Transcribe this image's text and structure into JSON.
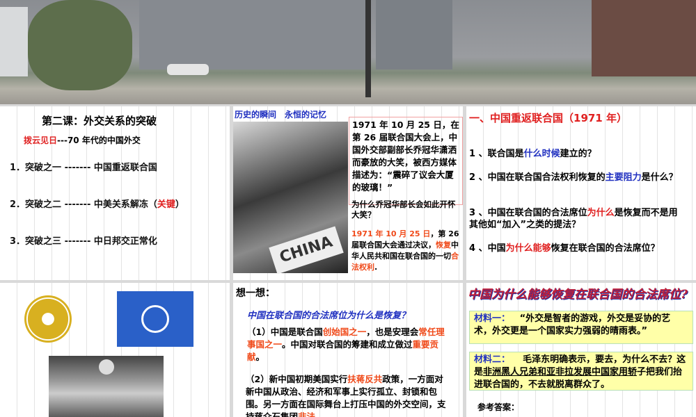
{
  "p1": {
    "title": "第二课：外交关系的突破",
    "subtitle_red": "拨云见日",
    "subtitle_rest": "---70 年代的中国外交",
    "items": [
      {
        "text": "1．突破之一 ------- 中国重返联合国"
      },
      {
        "text": "2．突破之二 ------- 中美关系解冻（",
        "key": "关键",
        "end": "）"
      },
      {
        "text": "3．突破之三 ------- 中日邦交正常化"
      }
    ]
  },
  "p2": {
    "header": "历史的瞬间　永恒的记忆",
    "photo_label": "CHINA",
    "quote": "1971 年 10 月 25 日，在第 26 届联合国大会上，中国外交部副部长乔冠华潇洒而豪放的大笑，被西方媒体描述为：“震碎了议会大厦的玻璃！”",
    "question": "为什么乔冠华部长会如此开怀大笑？",
    "ans": {
      "date": "1971 年 10 月 25 日",
      "t1": "，第 26 届联合国大会通过决议，",
      "restore": "恢复",
      "t2": "中华人民共和国在联合国的一切",
      "rights": "合法权利",
      "t3": "."
    }
  },
  "p3": {
    "title": "一、中国重返联合国（1971 年）",
    "q1": {
      "a": "1 、联合国是",
      "h": "什么时候",
      "b": "建立的？"
    },
    "q2": {
      "a": "2 、中国在联合国合法权利恢复的",
      "h": "主要阻力",
      "b": "是什么？"
    },
    "q3": {
      "a": "3 、中国在联合国的合法席位",
      "h": "为什么",
      "b": "是恢复而不是用其他如“加入”之类的提法？"
    },
    "q4": {
      "a": "4 、中国",
      "h": "为什么能够",
      "b": "恢复在联合国的合法席位？"
    }
  },
  "p5": {
    "title": "想一想：",
    "question": "中国在联合国的合法席位为什么是恢复？",
    "a1": {
      "t1": "（1）中国是联合国",
      "h1": "创始国之一",
      "t2": "，也是安理会",
      "h2": "常任理事国之一",
      "t3": "。中国对联合国的筹建和成立做过",
      "h3": "重要贡献",
      "t4": "。"
    },
    "a2": {
      "t1": "（2）新中国初期美国实行",
      "h1": "扶蒋反共",
      "t2": "政策，一方面对新中国从政治、经济和军事上实行孤立、封锁和包围。另一方面在国际舞台上打压中国的外交空间，支持蒋介石集团",
      "h2": "非法"
    }
  },
  "p6": {
    "title": "中国为什么能够恢复在联合国的合法席位?",
    "m1_label": "材料一：",
    "m1_text": "“外交是智者的游戏，外交是妥协的艺术，外交更是一个国家实力强弱的晴雨表。”",
    "m2_label": "材料二：",
    "m2_a": "毛泽东明确表示，要去，为什么不去？这是",
    "m2_u": "非洲黑人兄弟和亚非拉发展中国家用轿",
    "m2_b": "子把我们抬进联合国的，不去就脱离群众了。",
    "answer_label": "参考答案："
  },
  "colors": {
    "red": "#e02020",
    "blue": "#2030c0",
    "yellow_box": "#ffffa8"
  }
}
